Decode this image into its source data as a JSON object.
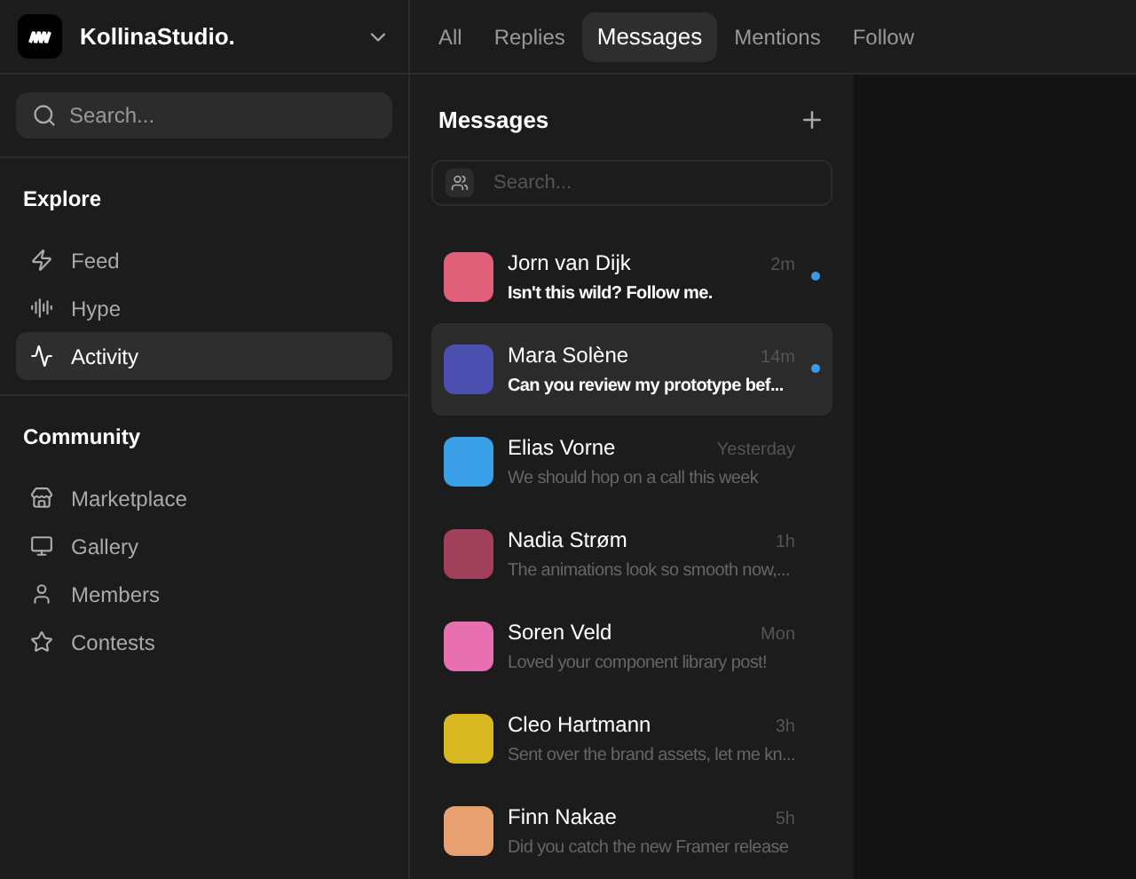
{
  "workspace": {
    "name": "KollinaStudio."
  },
  "sidebar": {
    "search": {
      "placeholder": "Search..."
    },
    "sections": [
      {
        "title": "Explore",
        "items": [
          {
            "label": "Feed",
            "selected": false
          },
          {
            "label": "Hype",
            "selected": false
          },
          {
            "label": "Activity",
            "selected": true
          }
        ]
      },
      {
        "title": "Community",
        "items": [
          {
            "label": "Marketplace",
            "selected": false
          },
          {
            "label": "Gallery",
            "selected": false
          },
          {
            "label": "Members",
            "selected": false
          },
          {
            "label": "Contests",
            "selected": false
          }
        ]
      }
    ]
  },
  "tabs": [
    {
      "label": "All",
      "selected": false
    },
    {
      "label": "Replies",
      "selected": false
    },
    {
      "label": "Messages",
      "selected": true
    },
    {
      "label": "Mentions",
      "selected": false
    },
    {
      "label": "Follow",
      "selected": false
    }
  ],
  "messages": {
    "title": "Messages",
    "search": {
      "placeholder": "Search..."
    },
    "items": [
      {
        "name": "Jorn van Dijk",
        "time": "2m",
        "preview": "Isn't this wild? Follow me.",
        "unread": true,
        "selected": false,
        "color": "#e0607a"
      },
      {
        "name": "Mara Solène",
        "time": "14m",
        "preview": "Can you review my prototype bef...",
        "unread": true,
        "selected": true,
        "color": "#4a4fb0"
      },
      {
        "name": "Elias Vorne",
        "time": "Yesterday",
        "preview": "We should hop on a call this week",
        "unread": false,
        "selected": false,
        "color": "#3aa0e8"
      },
      {
        "name": "Nadia Strøm",
        "time": "1h",
        "preview": "The animations look so smooth now,...",
        "unread": false,
        "selected": false,
        "color": "#a0405a"
      },
      {
        "name": "Soren Veld",
        "time": "Mon",
        "preview": "Loved your component library post!",
        "unread": false,
        "selected": false,
        "color": "#e870b0"
      },
      {
        "name": "Cleo Hartmann",
        "time": "3h",
        "preview": "Sent over the brand assets, let me kn...",
        "unread": false,
        "selected": false,
        "color": "#d8b820"
      },
      {
        "name": "Finn Nakae",
        "time": "5h",
        "preview": "Did you catch the new Framer release",
        "unread": false,
        "selected": false,
        "color": "#e8a070"
      }
    ]
  }
}
